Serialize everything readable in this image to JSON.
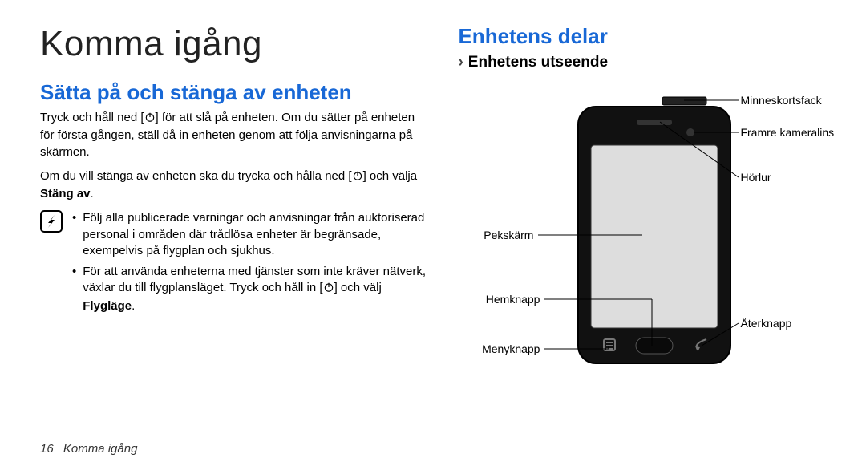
{
  "header": {
    "title": "Komma igång"
  },
  "section_power": {
    "heading": "Sätta på och stänga av enheten",
    "p1a": "Tryck och håll ned [",
    "p1b": "] för att slå på enheten. Om du sätter på enheten för första gången, ställ då in enheten genom att följa anvisningarna på skärmen.",
    "p2a": "Om du vill stänga av enheten ska du trycka och hålla ned [",
    "p2b": "] och välja ",
    "p2_bold": "Stäng av",
    "p2c": ".",
    "note1": "Följ alla publicerade varningar och anvisningar från auktoriserad personal i områden där trådlösa enheter är begränsade, exempelvis på flygplan och sjukhus.",
    "note2a": "För att använda enheterna med tjänster som inte kräver nätverk, växlar du till flygplansläget. Tryck och håll in [",
    "note2b": "] och välj ",
    "note2_bold": "Flygläge",
    "note2c": "."
  },
  "section_parts": {
    "heading": "Enhetens delar",
    "subheading": "Enhetens utseende",
    "labels": {
      "memory_slot": "Minneskortsfack",
      "front_cam": "Framre kameralins",
      "earpiece": "Hörlur",
      "touchscreen": "Pekskärm",
      "home": "Hemknapp",
      "back": "Återknapp",
      "menu": "Menyknapp"
    }
  },
  "footer": {
    "page_number": "16",
    "running_title": "Komma igång"
  },
  "icons": {
    "note": "note-icon",
    "power": "power-icon",
    "chevron": "›"
  },
  "bullet": "•"
}
